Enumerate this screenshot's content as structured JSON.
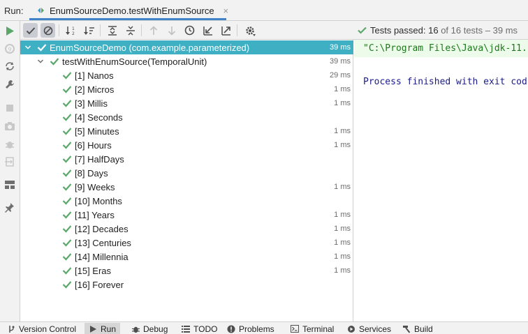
{
  "run_header": {
    "label": "Run:",
    "tab_title": "EnumSourceDemo.testWithEnumSource",
    "tab_close": "×"
  },
  "status": {
    "text_main": "Tests passed: ",
    "passed": "16",
    "text_rest": " of 16 tests – 39 ms"
  },
  "tree": {
    "root": {
      "label": "EnumSourceDemo (com.example.parameterized)",
      "time": "39 ms"
    },
    "method": {
      "label": "testWithEnumSource(TemporalUnit)",
      "time": "39 ms"
    },
    "items": [
      {
        "label": "[1] Nanos",
        "time": "29 ms"
      },
      {
        "label": "[2] Micros",
        "time": "1 ms"
      },
      {
        "label": "[3] Millis",
        "time": "1 ms"
      },
      {
        "label": "[4] Seconds",
        "time": ""
      },
      {
        "label": "[5] Minutes",
        "time": "1 ms"
      },
      {
        "label": "[6] Hours",
        "time": "1 ms"
      },
      {
        "label": "[7] HalfDays",
        "time": ""
      },
      {
        "label": "[8] Days",
        "time": ""
      },
      {
        "label": "[9] Weeks",
        "time": "1 ms"
      },
      {
        "label": "[10] Months",
        "time": ""
      },
      {
        "label": "[11] Years",
        "time": "1 ms"
      },
      {
        "label": "[12] Decades",
        "time": "1 ms"
      },
      {
        "label": "[13] Centuries",
        "time": "1 ms"
      },
      {
        "label": "[14] Millennia",
        "time": "1 ms"
      },
      {
        "label": "[15] Eras",
        "time": "1 ms"
      },
      {
        "label": "[16] Forever",
        "time": ""
      }
    ]
  },
  "console": {
    "command": "\"C:\\Program Files\\Java\\jdk-11.",
    "exit": "Process finished with exit cod"
  },
  "bottom_bar": {
    "items": [
      {
        "label": "Version Control",
        "icon": "branch-icon"
      },
      {
        "label": "Run",
        "icon": "run-icon"
      },
      {
        "label": "Debug",
        "icon": "bug-icon"
      },
      {
        "label": "TODO",
        "icon": "list-icon"
      },
      {
        "label": "Problems",
        "icon": "warning-icon"
      },
      {
        "label": "Terminal",
        "icon": "terminal-icon"
      },
      {
        "label": "Services",
        "icon": "services-icon"
      },
      {
        "label": "Build",
        "icon": "hammer-icon"
      }
    ]
  },
  "colors": {
    "selection": "#3fb0c4",
    "check": "#59a869",
    "console_green": "#1a7a1a",
    "console_blue": "#1a1a8c"
  }
}
